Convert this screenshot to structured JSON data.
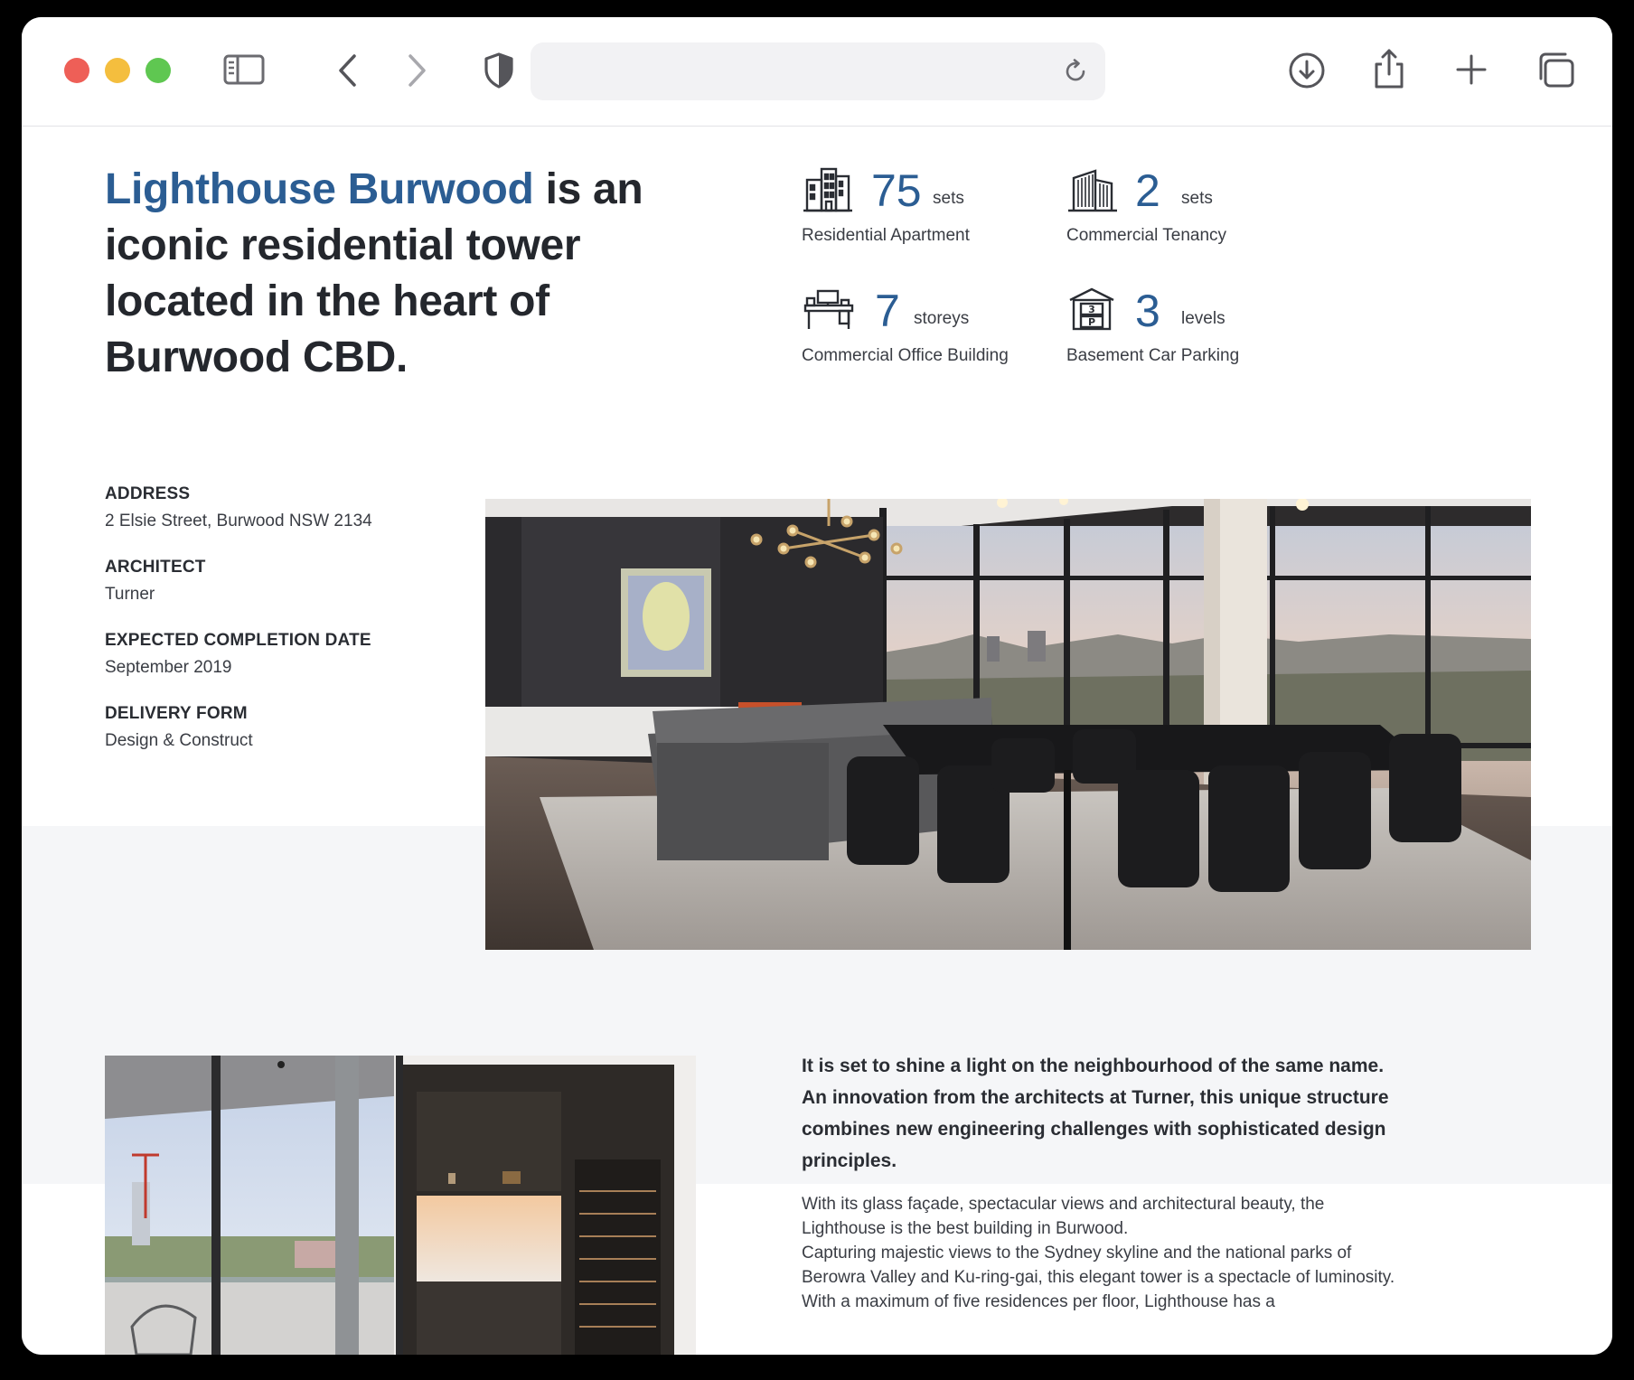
{
  "browser": {
    "url": "",
    "icons": [
      "sidebar-icon",
      "back-icon",
      "forward-icon",
      "shield-icon",
      "reload-icon",
      "download-icon",
      "share-icon",
      "new-tab-icon",
      "tabs-overview-icon"
    ]
  },
  "hero": {
    "title_accent": "Lighthouse Burwood",
    "title_rest": " is an iconic residential tower located in the heart of Burwood CBD."
  },
  "stats": [
    {
      "icon": "apartment-building-icon",
      "value": "75",
      "unit": "sets",
      "label": "Residential Apartment"
    },
    {
      "icon": "commercial-building-icon",
      "value": "2",
      "unit": "sets",
      "label": "Commercial Tenancy"
    },
    {
      "icon": "office-desk-icon",
      "value": "7",
      "unit": "storeys",
      "label": "Commercial Office Building"
    },
    {
      "icon": "parking-icon",
      "value": "3",
      "unit": "levels",
      "label": "Basement Car Parking"
    }
  ],
  "details": [
    {
      "key": "ADDRESS",
      "value": "2 Elsie Street, Burwood NSW 2134"
    },
    {
      "key": "ARCHITECT",
      "value": "Turner"
    },
    {
      "key": "EXPECTED COMPLETION DATE",
      "value": "September 2019"
    },
    {
      "key": "DELIVERY FORM",
      "value": "Design & Construct"
    }
  ],
  "copy": {
    "lead": "It is set to shine a light on the neighbourhood of the same name. An innovation from the architects at Turner, this unique structure combines new engineering challenges with sophisticated design principles.",
    "para1": "With its glass façade, spectacular views and architectural beauty, the Lighthouse is the best building in Burwood.",
    "para2": "Capturing majestic views to the Sydney skyline and the national parks of Berowra Valley and Ku-ring-gai, this elegant tower is a spectacle of luminosity. With a maximum of five residences per floor, Lighthouse has a"
  }
}
